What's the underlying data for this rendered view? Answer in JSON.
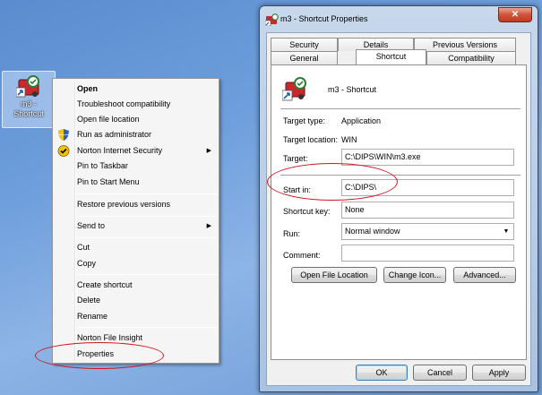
{
  "desktop": {
    "icon_label_line1": "m3 -",
    "icon_label_line2": "Shortcut"
  },
  "context_menu": {
    "items": [
      {
        "label": "Open",
        "bold": true
      },
      {
        "label": "Troubleshoot compatibility"
      },
      {
        "label": "Open file location"
      },
      {
        "label": "Run as administrator",
        "icon": "shield-icon"
      },
      {
        "label": "Norton Internet Security",
        "icon": "norton-icon",
        "submenu": true
      },
      {
        "label": "Pin to Taskbar"
      },
      {
        "label": "Pin to Start Menu"
      },
      {
        "label": "Restore previous versions"
      },
      {
        "label": "Send to",
        "submenu": true
      },
      {
        "label": "Cut"
      },
      {
        "label": "Copy"
      },
      {
        "label": "Create shortcut"
      },
      {
        "label": "Delete"
      },
      {
        "label": "Rename"
      },
      {
        "label": "Norton File Insight"
      },
      {
        "label": "Properties"
      }
    ]
  },
  "window": {
    "title": "m3 - Shortcut Properties",
    "close_glyph": "✕",
    "tabs_row1": [
      "Security",
      "Details",
      "Previous Versions"
    ],
    "tabs_row2": [
      "General",
      "Shortcut",
      "Compatibility"
    ],
    "active_tab": "Shortcut",
    "shortcut_name": "m3 - Shortcut",
    "fields": {
      "target_type_label": "Target type:",
      "target_type_value": "Application",
      "target_location_label": "Target location:",
      "target_location_value": "WIN",
      "target_label": "Target:",
      "target_value": "C:\\DIPS\\WIN\\m3.exe",
      "start_in_label": "Start in:",
      "start_in_value": "C:\\DIPS\\",
      "shortcut_key_label": "Shortcut key:",
      "shortcut_key_value": "None",
      "run_label": "Run:",
      "run_value": "Normal window",
      "comment_label": "Comment:",
      "comment_value": ""
    },
    "buttons": {
      "open_file_location": "Open File Location",
      "change_icon": "Change Icon...",
      "advanced": "Advanced...",
      "ok": "OK",
      "cancel": "Cancel",
      "apply": "Apply"
    }
  },
  "colors": {
    "annotation_red": "#d4141c",
    "desktop_blue": "#6f9fdc"
  }
}
